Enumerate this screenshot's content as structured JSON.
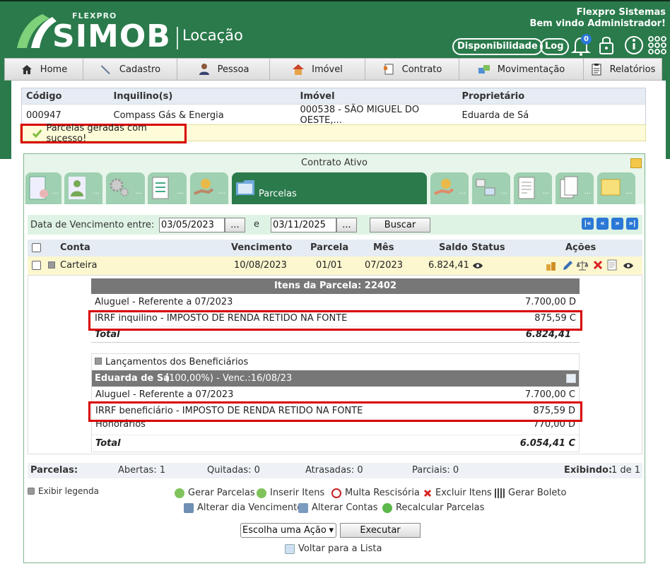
{
  "brand": {
    "small": "FLEXPRO",
    "name": "SIMOB",
    "module": "Locação"
  },
  "user": {
    "company": "Flexpro Sistemas",
    "welcome": "Bem vindo Administrador!"
  },
  "top_buttons": {
    "availability": "Disponibilidade",
    "log": "Log",
    "notifications": "0"
  },
  "nav": [
    "Home",
    "Cadastro",
    "Pessoa",
    "Imóvel",
    "Contrato",
    "Movimentação",
    "Relatórios"
  ],
  "contract_info": {
    "headers": [
      "Código",
      "Inquilino(s)",
      "Imóvel",
      "Proprietário"
    ],
    "values": [
      "000947",
      "Compass Gás & Energia",
      "000538 - SÃO MIGUEL DO OESTE,...",
      "Eduarda de Sá"
    ]
  },
  "message": "Parcelas geradas com sucesso!",
  "panel": {
    "title": "Contrato Ativo",
    "active_tab": "Parcelas",
    "tab_more": "..."
  },
  "filter": {
    "label": "Data de Vencimento entre:",
    "from": "03/05/2023",
    "to": "03/11/2025",
    "and": "e",
    "dots": "...",
    "search": "Buscar"
  },
  "grid": {
    "headers": {
      "conta": "Conta",
      "venc": "Vencimento",
      "parcela": "Parcela",
      "mes": "Mês",
      "saldo": "Saldo",
      "status": "Status",
      "acoes": "Ações"
    },
    "row": {
      "conta": "Carteira",
      "venc": "10/08/2023",
      "parcela": "01/01",
      "mes": "07/2023",
      "saldo": "6.824,41"
    }
  },
  "items": {
    "title": "Itens da Parcela: 22402",
    "rows": [
      {
        "label": "Aluguel - Referente a 07/2023",
        "value": "7.700,00 D"
      },
      {
        "label": "IRRF inquilino - IMPOSTO DE RENDA RETIDO NA FONTE",
        "value": "875,59 C"
      }
    ],
    "total_label": "Total",
    "total": "6.824,41"
  },
  "benef": {
    "toggle": "Lançamentos dos Beneficiários",
    "name": "Eduarda de Sá",
    "pct": "(100,00%) - Venc.:16/08/23",
    "rows": [
      {
        "label": "Aluguel - Referente a 07/2023",
        "value": "7.700,00 C"
      },
      {
        "label": "IRRF beneficiário - IMPOSTO DE RENDA RETIDO NA FONTE",
        "value": "875,59 D"
      },
      {
        "label": "Honorários",
        "value": "770,00 D"
      }
    ],
    "total_label": "Total",
    "total": "6.054,41 C"
  },
  "summary": {
    "label": "Parcelas:",
    "abertas": "Abertas: 1",
    "quitadas": "Quitadas: 0",
    "atrasadas": "Atrasadas: 0",
    "parciais": "Parciais: 0",
    "exibindo_label": "Exibindo:",
    "exibindo": "1 de 1"
  },
  "legend": "Exibir legenda",
  "actions": {
    "gerar": "Gerar Parcelas",
    "inserir": "Inserir Itens",
    "multa": "Multa Rescisória",
    "excluir": "Excluir Itens",
    "boleto": "Gerar Boleto",
    "alterar_venc": "Alterar dia Vencimento",
    "alterar_contas": "Alterar Contas",
    "recalcular": "Recalcular Parcelas"
  },
  "select": {
    "value": "Escolha uma Ação",
    "execute": "Executar"
  },
  "back": "Voltar para a Lista",
  "colors": {
    "header": "#2a7a4b",
    "tab": "#9fd0b1",
    "highlight": "#d80000"
  }
}
